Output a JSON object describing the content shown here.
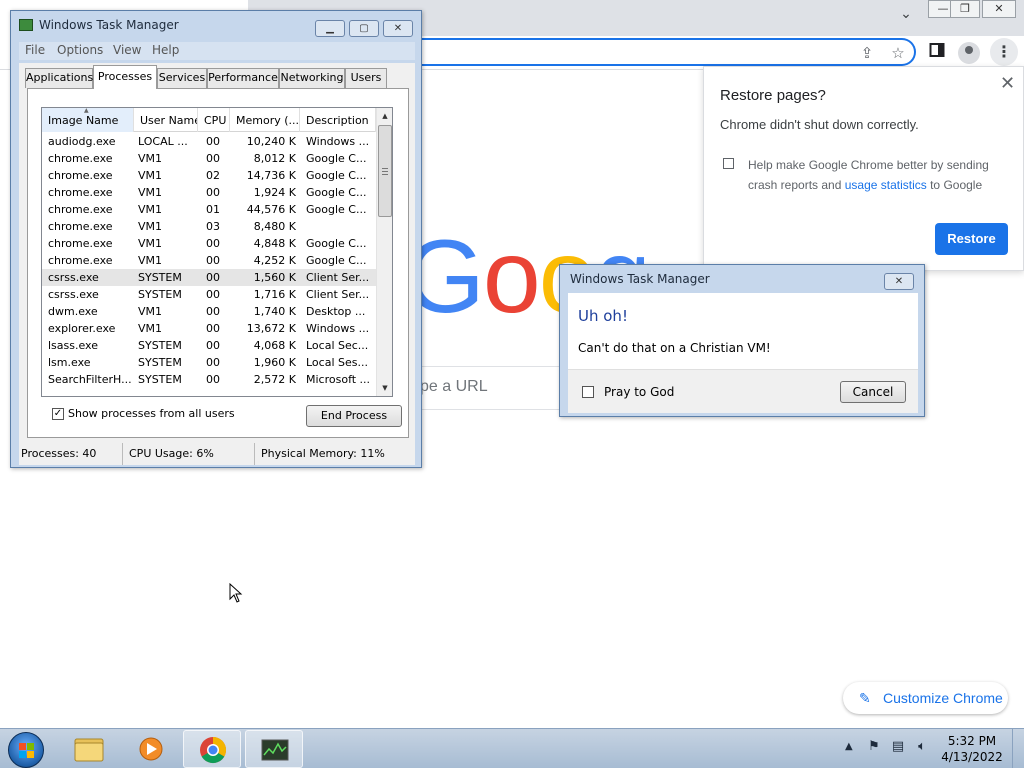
{
  "browser": {
    "tab_dropdown_icon": "chevron-down-icon",
    "search_hint": "pe a URL",
    "logo_text": "Goog",
    "customize_label": "Customize Chrome",
    "restore_popup": {
      "title": "Restore pages?",
      "message": "Chrome didn't shut down correctly.",
      "help_text_1": "Help make Google Chrome better by sending crash reports and ",
      "help_link": "usage statistics",
      "help_text_2": " to Google",
      "help_checked": false,
      "restore_button": "Restore"
    }
  },
  "task_manager": {
    "title": "Windows Task Manager",
    "menu": [
      "File",
      "Options",
      "View",
      "Help"
    ],
    "tabs": [
      "Applications",
      "Processes",
      "Services",
      "Performance",
      "Networking",
      "Users"
    ],
    "active_tab": "Processes",
    "columns": [
      "Image Name",
      "User Name",
      "CPU",
      "Memory (...",
      "Description"
    ],
    "rows": [
      {
        "name": "audiodg.exe",
        "user": "LOCAL ...",
        "cpu": "00",
        "mem": "10,240 K",
        "desc": "Windows ..."
      },
      {
        "name": "chrome.exe",
        "user": "VM1",
        "cpu": "00",
        "mem": "8,012 K",
        "desc": "Google C..."
      },
      {
        "name": "chrome.exe",
        "user": "VM1",
        "cpu": "02",
        "mem": "14,736 K",
        "desc": "Google C..."
      },
      {
        "name": "chrome.exe",
        "user": "VM1",
        "cpu": "00",
        "mem": "1,924 K",
        "desc": "Google C..."
      },
      {
        "name": "chrome.exe",
        "user": "VM1",
        "cpu": "01",
        "mem": "44,576 K",
        "desc": "Google C..."
      },
      {
        "name": "chrome.exe",
        "user": "VM1",
        "cpu": "03",
        "mem": "8,480 K",
        "desc": ""
      },
      {
        "name": "chrome.exe",
        "user": "VM1",
        "cpu": "00",
        "mem": "4,848 K",
        "desc": "Google C..."
      },
      {
        "name": "chrome.exe",
        "user": "VM1",
        "cpu": "00",
        "mem": "4,252 K",
        "desc": "Google C..."
      },
      {
        "name": "csrss.exe",
        "user": "SYSTEM",
        "cpu": "00",
        "mem": "1,560 K",
        "desc": "Client Ser..."
      },
      {
        "name": "csrss.exe",
        "user": "SYSTEM",
        "cpu": "00",
        "mem": "1,716 K",
        "desc": "Client Ser..."
      },
      {
        "name": "dwm.exe",
        "user": "VM1",
        "cpu": "00",
        "mem": "1,740 K",
        "desc": "Desktop ..."
      },
      {
        "name": "explorer.exe",
        "user": "VM1",
        "cpu": "00",
        "mem": "13,672 K",
        "desc": "Windows ..."
      },
      {
        "name": "lsass.exe",
        "user": "SYSTEM",
        "cpu": "00",
        "mem": "4,068 K",
        "desc": "Local Sec..."
      },
      {
        "name": "lsm.exe",
        "user": "SYSTEM",
        "cpu": "00",
        "mem": "1,960 K",
        "desc": "Local Ses..."
      },
      {
        "name": "SearchFilterH...",
        "user": "SYSTEM",
        "cpu": "00",
        "mem": "2,572 K",
        "desc": "Microsoft ..."
      }
    ],
    "highlighted_row": 8,
    "show_all_label": "Show processes from all users",
    "show_all_checked": true,
    "end_process_label": "End Process",
    "status": {
      "processes": "Processes: 40",
      "cpu": "CPU Usage: 6%",
      "memory": "Physical Memory: 11%"
    }
  },
  "dialog": {
    "title": "Windows Task Manager",
    "heading": "Uh oh!",
    "message": "Can't do that on a Christian VM!",
    "checkbox_label": "Pray to God",
    "checkbox_checked": false,
    "cancel_label": "Cancel"
  },
  "taskbar": {
    "apps": [
      "explorer",
      "media-player",
      "chrome",
      "task-manager"
    ],
    "time": "5:32 PM",
    "date": "4/13/2022"
  }
}
